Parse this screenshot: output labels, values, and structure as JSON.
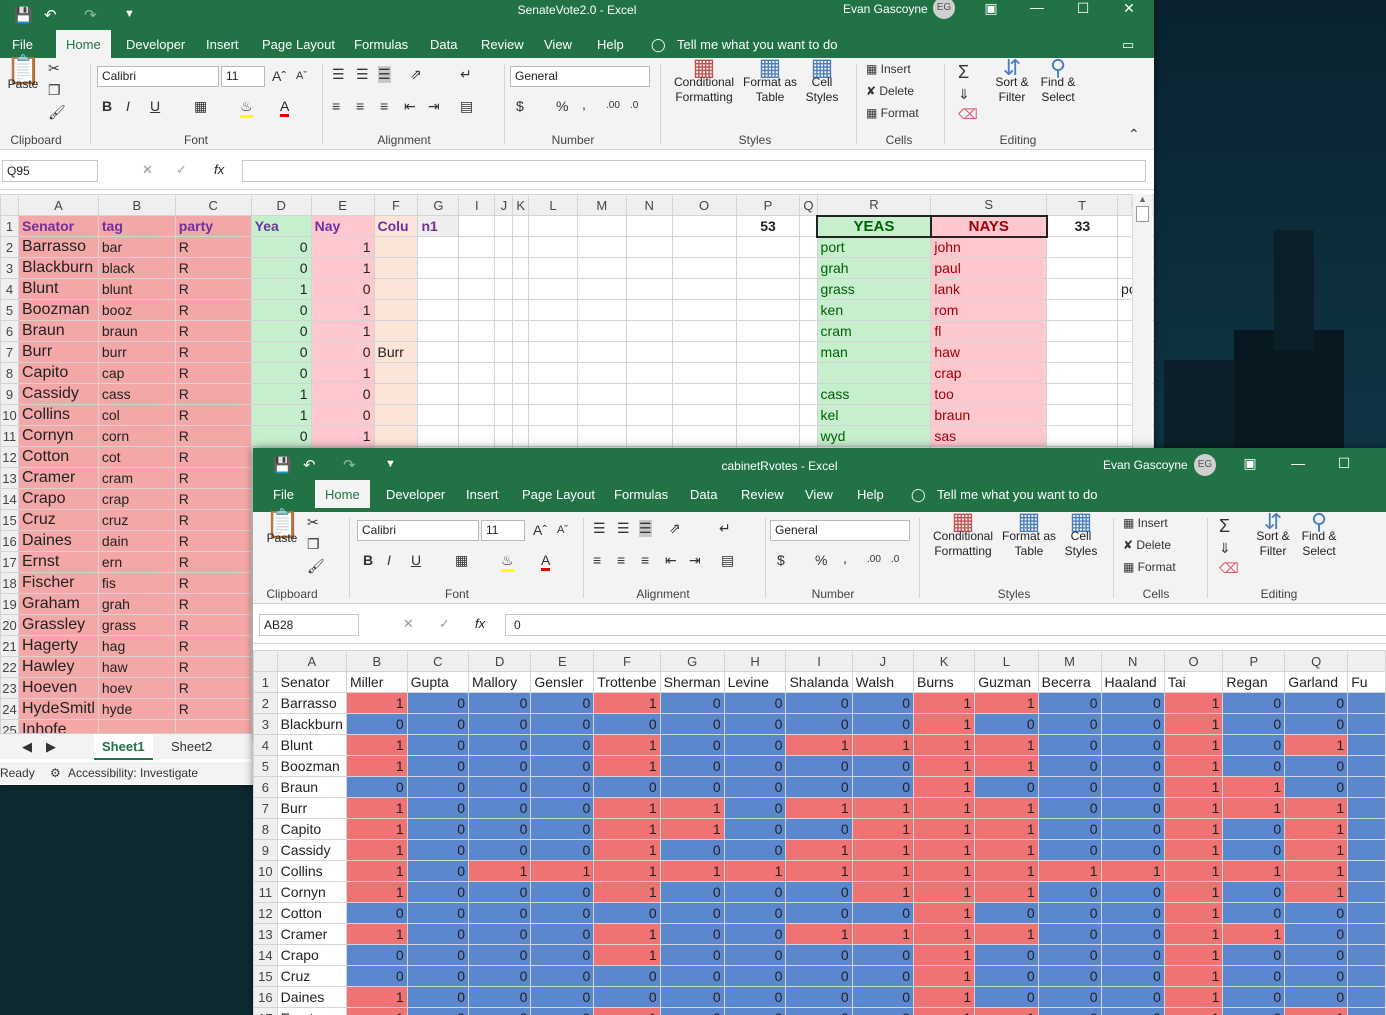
{
  "win1": {
    "title": "SenateVote2.0  -  Excel",
    "user": "Evan Gascoyne",
    "initials": "EG",
    "tabs": [
      "File",
      "Home",
      "Developer",
      "Insert",
      "Page Layout",
      "Formulas",
      "Data",
      "Review",
      "View",
      "Help"
    ],
    "tell": "Tell me what you want to do",
    "font": "Calibri",
    "size": "11",
    "numfmt": "General",
    "groups": {
      "clipboard": "Clipboard",
      "font": "Font",
      "alignment": "Alignment",
      "number": "Number",
      "styles": "Styles",
      "cells": "Cells",
      "editing": "Editing"
    },
    "paste": "Paste",
    "cond1": "Conditional",
    "cond2": "Formatting",
    "fat1": "Format as",
    "fat2": "Table",
    "cs1": "Cell",
    "cs2": "Styles",
    "insert": "Insert",
    "delete": "Delete",
    "format": "Format",
    "sort1": "Sort &",
    "sort2": "Filter",
    "find1": "Find &",
    "find2": "Select",
    "namebox": "Q95",
    "cols": [
      "A",
      "B",
      "C",
      "D",
      "E",
      "F",
      "G",
      "I",
      "J",
      "K",
      "L",
      "M",
      "N",
      "O",
      "P",
      "Q",
      "R",
      "S",
      "T",
      "U"
    ],
    "headers": {
      "senator": "Senator",
      "tag": "tag",
      "party": "party",
      "yea": "Yea",
      "nay": "Nay",
      "col": "Colu",
      "col2": "n1",
      "p": "53",
      "yeas": "YEAS",
      "nays": "NAYS",
      "t": "33"
    },
    "rows": [
      {
        "n": "2",
        "a": "Barrasso",
        "b": "bar",
        "c": "R",
        "d": "0",
        "e": "1",
        "f": "",
        "r": "port",
        "s": "john",
        "u": ""
      },
      {
        "n": "3",
        "a": "Blackburn",
        "b": "black",
        "c": "R",
        "d": "0",
        "e": "1",
        "f": "",
        "r": "grah",
        "s": "paul",
        "u": ""
      },
      {
        "n": "4",
        "a": "Blunt",
        "b": "blunt",
        "c": "R",
        "d": "1",
        "e": "0",
        "f": "",
        "r": "grass",
        "s": "lank",
        "u": "polly"
      },
      {
        "n": "5",
        "a": "Boozman",
        "b": "booz",
        "c": "R",
        "d": "0",
        "e": "1",
        "f": "",
        "r": "ken",
        "s": "rom",
        "u": ""
      },
      {
        "n": "6",
        "a": "Braun",
        "b": "braun",
        "c": "R",
        "d": "0",
        "e": "1",
        "f": "",
        "r": "cram",
        "s": "fl",
        "u": ""
      },
      {
        "n": "7",
        "a": "Burr",
        "b": "burr",
        "c": "R",
        "d": "0",
        "e": "0",
        "f": "Burr",
        "r": "man",
        "s": "haw",
        "u": ""
      },
      {
        "n": "8",
        "a": "Capito",
        "b": "cap",
        "c": "R",
        "d": "0",
        "e": "1",
        "f": "",
        "r": "",
        "s": "crap",
        "u": ""
      },
      {
        "n": "9",
        "a": "Cassidy",
        "b": "cass",
        "c": "R",
        "d": "1",
        "e": "0",
        "f": "",
        "r": "cass",
        "s": "too",
        "u": ""
      },
      {
        "n": "10",
        "a": "Collins",
        "b": "col",
        "c": "R",
        "d": "1",
        "e": "0",
        "f": "",
        "r": "kel",
        "s": "braun",
        "u": ""
      },
      {
        "n": "11",
        "a": "Cornyn",
        "b": "corn",
        "c": "R",
        "d": "0",
        "e": "1",
        "f": "",
        "r": "wyd",
        "s": "sas",
        "u": ""
      },
      {
        "n": "12",
        "a": "Cotton",
        "b": "cot",
        "c": "R"
      },
      {
        "n": "13",
        "a": "Cramer",
        "b": "cram",
        "c": "R"
      },
      {
        "n": "14",
        "a": "Crapo",
        "b": "crap",
        "c": "R"
      },
      {
        "n": "15",
        "a": "Cruz",
        "b": "cruz",
        "c": "R"
      },
      {
        "n": "16",
        "a": "Daines",
        "b": "dain",
        "c": "R"
      },
      {
        "n": "17",
        "a": "Ernst",
        "b": "ern",
        "c": "R"
      },
      {
        "n": "18",
        "a": "Fischer",
        "b": "fis",
        "c": "R"
      },
      {
        "n": "19",
        "a": "Graham",
        "b": "grah",
        "c": "R"
      },
      {
        "n": "20",
        "a": "Grassley",
        "b": "grass",
        "c": "R"
      },
      {
        "n": "21",
        "a": "Hagerty",
        "b": "hag",
        "c": "R"
      },
      {
        "n": "22",
        "a": "Hawley",
        "b": "haw",
        "c": "R"
      },
      {
        "n": "23",
        "a": "Hoeven",
        "b": "hoev",
        "c": "R"
      },
      {
        "n": "24",
        "a": "HydeSmitl",
        "b": "hyde",
        "c": "R"
      },
      {
        "n": "25",
        "a": "Inhofe",
        "b": "",
        "c": ""
      }
    ],
    "sheets": [
      "Sheet1",
      "Sheet2"
    ],
    "status": "Ready",
    "accessibility": "Accessibility: Investigate"
  },
  "win2": {
    "title": "cabinetRvotes  -  Excel",
    "user": "Evan Gascoyne",
    "initials": "EG",
    "tabs": [
      "File",
      "Home",
      "Developer",
      "Insert",
      "Page Layout",
      "Formulas",
      "Data",
      "Review",
      "View",
      "Help"
    ],
    "tell": "Tell me what you want to do",
    "font": "Calibri",
    "size": "11",
    "numfmt": "General",
    "namebox": "AB28",
    "formula": "0",
    "cols": [
      "A",
      "B",
      "C",
      "D",
      "E",
      "F",
      "G",
      "H",
      "I",
      "J",
      "K",
      "L",
      "M",
      "N",
      "O",
      "P",
      "Q"
    ],
    "headers": [
      "Senator",
      "Miller",
      "Gupta",
      "Mallory",
      "Gensler",
      "Trottenbe",
      "Sherman",
      "Levine",
      "Shalanda",
      "Walsh",
      "Burns",
      "Guzman",
      "Becerra",
      "Haaland",
      "Tai",
      "Regan",
      "Garland",
      "Fu"
    ],
    "rows": [
      {
        "n": "2",
        "name": "Barrasso",
        "v": [
          1,
          0,
          0,
          0,
          1,
          0,
          0,
          0,
          0,
          1,
          1,
          0,
          0,
          1,
          0,
          0
        ]
      },
      {
        "n": "3",
        "name": "Blackburn",
        "v": [
          0,
          0,
          0,
          0,
          0,
          0,
          0,
          0,
          0,
          1,
          0,
          0,
          0,
          1,
          0,
          0
        ]
      },
      {
        "n": "4",
        "name": "Blunt",
        "v": [
          1,
          0,
          0,
          0,
          1,
          0,
          0,
          1,
          1,
          1,
          1,
          0,
          0,
          1,
          0,
          1
        ]
      },
      {
        "n": "5",
        "name": "Boozman",
        "v": [
          1,
          0,
          0,
          0,
          1,
          0,
          0,
          0,
          0,
          1,
          1,
          0,
          0,
          1,
          0,
          0
        ]
      },
      {
        "n": "6",
        "name": "Braun",
        "v": [
          0,
          0,
          0,
          0,
          0,
          0,
          0,
          0,
          0,
          1,
          0,
          0,
          0,
          1,
          1,
          0
        ]
      },
      {
        "n": "7",
        "name": "Burr",
        "v": [
          1,
          0,
          0,
          0,
          1,
          1,
          0,
          1,
          1,
          1,
          1,
          0,
          0,
          1,
          1,
          1
        ]
      },
      {
        "n": "8",
        "name": "Capito",
        "v": [
          1,
          0,
          0,
          0,
          1,
          1,
          0,
          0,
          1,
          1,
          1,
          0,
          0,
          1,
          0,
          1
        ]
      },
      {
        "n": "9",
        "name": "Cassidy",
        "v": [
          1,
          0,
          0,
          0,
          1,
          0,
          0,
          1,
          1,
          1,
          1,
          0,
          0,
          1,
          0,
          1
        ]
      },
      {
        "n": "10",
        "name": "Collins",
        "v": [
          1,
          0,
          1,
          1,
          1,
          1,
          1,
          1,
          1,
          1,
          1,
          1,
          1,
          1,
          1,
          1
        ]
      },
      {
        "n": "11",
        "name": "Cornyn",
        "v": [
          1,
          0,
          0,
          0,
          1,
          0,
          0,
          0,
          1,
          1,
          1,
          0,
          0,
          1,
          0,
          1
        ]
      },
      {
        "n": "12",
        "name": "Cotton",
        "v": [
          0,
          0,
          0,
          0,
          0,
          0,
          0,
          0,
          0,
          1,
          0,
          0,
          0,
          1,
          0,
          0
        ]
      },
      {
        "n": "13",
        "name": "Cramer",
        "v": [
          1,
          0,
          0,
          0,
          1,
          0,
          0,
          1,
          1,
          1,
          1,
          0,
          0,
          1,
          1,
          0
        ]
      },
      {
        "n": "14",
        "name": "Crapo",
        "v": [
          0,
          0,
          0,
          0,
          1,
          0,
          0,
          0,
          0,
          1,
          0,
          0,
          0,
          1,
          0,
          0
        ]
      },
      {
        "n": "15",
        "name": "Cruz",
        "v": [
          0,
          0,
          0,
          0,
          0,
          0,
          0,
          0,
          0,
          1,
          0,
          0,
          0,
          1,
          0,
          0
        ]
      },
      {
        "n": "16",
        "name": "Daines",
        "v": [
          1,
          0,
          0,
          0,
          0,
          0,
          0,
          0,
          0,
          1,
          0,
          0,
          0,
          1,
          0,
          0
        ]
      },
      {
        "n": "17",
        "name": "Ernst",
        "v": [
          1,
          0,
          0,
          0,
          1,
          0,
          0,
          0,
          0,
          1,
          1,
          0,
          0,
          1,
          0,
          1
        ]
      }
    ]
  }
}
